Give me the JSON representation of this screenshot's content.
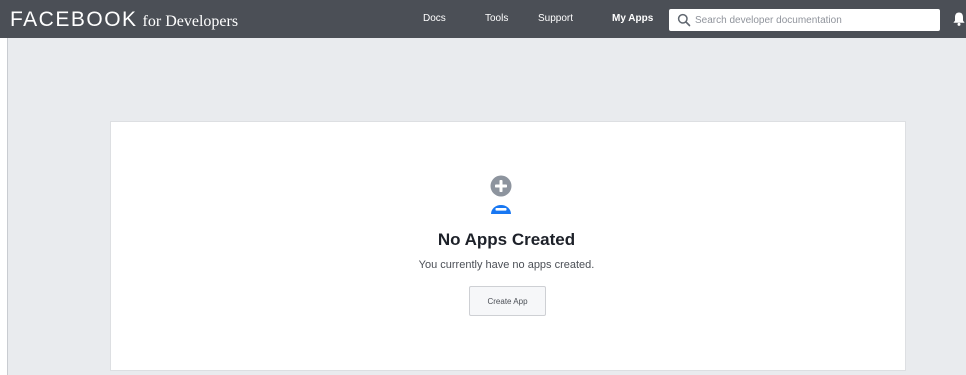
{
  "header": {
    "brand_main": "FACEBOOK",
    "brand_sub": "for Developers",
    "nav": [
      {
        "label": "Docs"
      },
      {
        "label": "Tools"
      },
      {
        "label": "Support"
      },
      {
        "label": "My Apps"
      }
    ],
    "search": {
      "placeholder": "Search developer documentation",
      "value": "",
      "icon": "search-icon"
    },
    "notifications_icon": "bell-icon"
  },
  "main": {
    "empty_state": {
      "icon": "add-app-icon",
      "title": "No Apps Created",
      "message": "You currently have no apps created.",
      "button_label": "Create App"
    }
  },
  "colors": {
    "header_bg": "#4b4f56",
    "page_bg": "#e9ebee",
    "accent_blue": "#1877f2",
    "icon_gray": "#8d949e"
  }
}
